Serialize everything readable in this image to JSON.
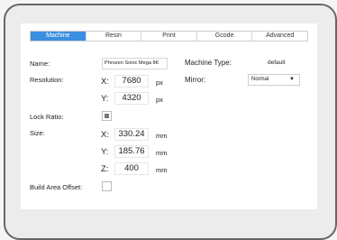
{
  "tabs": [
    {
      "label": "Machine",
      "active": true
    },
    {
      "label": "Resin",
      "active": false
    },
    {
      "label": "Print",
      "active": false
    },
    {
      "label": "Gcode",
      "active": false
    },
    {
      "label": "Advanced",
      "active": false
    }
  ],
  "form": {
    "name_label": "Name:",
    "name_value": "Phrozen Sonic Mega 8K",
    "machine_type_label": "Machine Type:",
    "machine_type_value": "default",
    "resolution_label": "Resolution:",
    "res_x_axis": "X:",
    "res_x_value": "7680",
    "res_x_unit": "px",
    "res_y_axis": "Y:",
    "res_y_value": "4320",
    "res_y_unit": "px",
    "mirror_label": "Mirror:",
    "mirror_value": "Normal",
    "lock_ratio_label": "Lock Ratio:",
    "lock_ratio_checked": true,
    "size_label": "Size:",
    "size_x_axis": "X:",
    "size_x_value": "330.24",
    "size_x_unit": "mm",
    "size_y_axis": "Y:",
    "size_y_value": "185.76",
    "size_y_unit": "mm",
    "size_z_axis": "Z:",
    "size_z_value": "400",
    "size_z_unit": "mm",
    "build_offset_label": "Build Area Offset:",
    "build_offset_checked": false
  },
  "colors": {
    "accent": "#3b8ee0"
  },
  "icons": {
    "dropdown": "chevron-down-icon"
  }
}
